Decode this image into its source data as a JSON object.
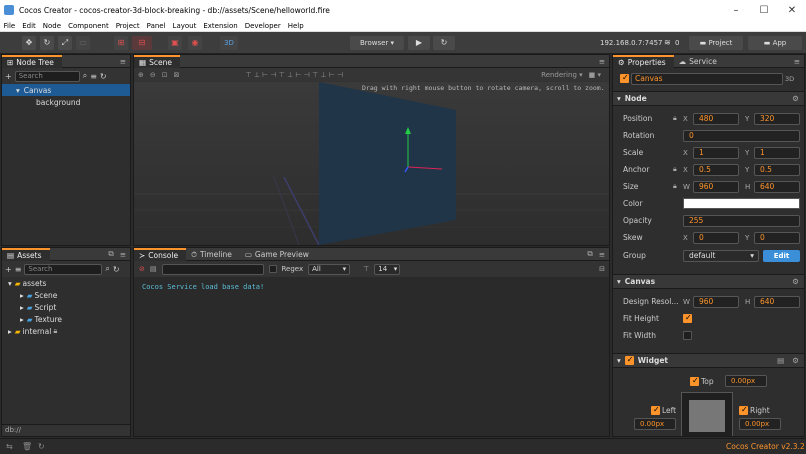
{
  "window": {
    "title": "Cocos Creator - cocos-creator-3d-block-breaking - db://assets/Scene/helloworld.fire",
    "controls": [
      "–",
      "☐",
      "✕"
    ]
  },
  "menu": [
    "File",
    "Edit",
    "Node",
    "Component",
    "Project",
    "Panel",
    "Layout",
    "Extension",
    "Developer",
    "Help"
  ],
  "toolbar": {
    "mode_3d": "3D",
    "browser": "Browser",
    "ip": "192.168.0.7:7457",
    "connections": "0",
    "project_btn": "Project",
    "app_btn": "App"
  },
  "node_tree": {
    "tab": "Node Tree",
    "search_placeholder": "Search",
    "items": [
      {
        "label": "Canvas"
      },
      {
        "label": "background"
      }
    ]
  },
  "scene": {
    "tab": "Scene",
    "hint": "Drag with right mouse button to rotate camera, scroll to zoom.",
    "rendering": "Rendering"
  },
  "assets": {
    "tab": "Assets",
    "search_placeholder": "Search",
    "items": [
      {
        "label": "assets"
      },
      {
        "label": "Scene"
      },
      {
        "label": "Script"
      },
      {
        "label": "Texture"
      },
      {
        "label": "internal"
      }
    ],
    "footer": "db://"
  },
  "console": {
    "tabs": [
      "Console",
      "Timeline",
      "Game Preview"
    ],
    "regex": "Regex",
    "filter": "All",
    "font_size": "14",
    "log": "Cocos Service load base data!"
  },
  "inspector": {
    "tabs": [
      "Properties",
      "Service"
    ],
    "node_name": "Canvas",
    "mode": "3D",
    "section_node": "Node",
    "position": {
      "label": "Position",
      "x": "480",
      "y": "320"
    },
    "rotation": {
      "label": "Rotation",
      "v": "0"
    },
    "scale": {
      "label": "Scale",
      "x": "1",
      "y": "1"
    },
    "anchor": {
      "label": "Anchor",
      "x": "0.5",
      "y": "0.5"
    },
    "size": {
      "label": "Size",
      "w": "960",
      "h": "640"
    },
    "color": {
      "label": "Color",
      "value": "#ffffff"
    },
    "opacity": {
      "label": "Opacity",
      "v": "255"
    },
    "skew": {
      "label": "Skew",
      "x": "0",
      "y": "0"
    },
    "group": {
      "label": "Group",
      "value": "default",
      "edit": "Edit"
    },
    "section_canvas": "Canvas",
    "design": {
      "label": "Design Resol...",
      "w": "960",
      "h": "640"
    },
    "fit_height": {
      "label": "Fit Height",
      "checked": true
    },
    "fit_width": {
      "label": "Fit Width",
      "checked": false
    },
    "section_widget": "Widget",
    "widget": {
      "top": "Top",
      "top_v": "0.00px",
      "left": "Left",
      "left_v": "0.00px",
      "right": "Right",
      "right_v": "0.00px"
    }
  },
  "status": {
    "version": "Cocos Creator v2.3.2"
  },
  "colors": {
    "accent": "#fd942b",
    "selection": "#1e5a94",
    "log": "#5bbcd6"
  }
}
